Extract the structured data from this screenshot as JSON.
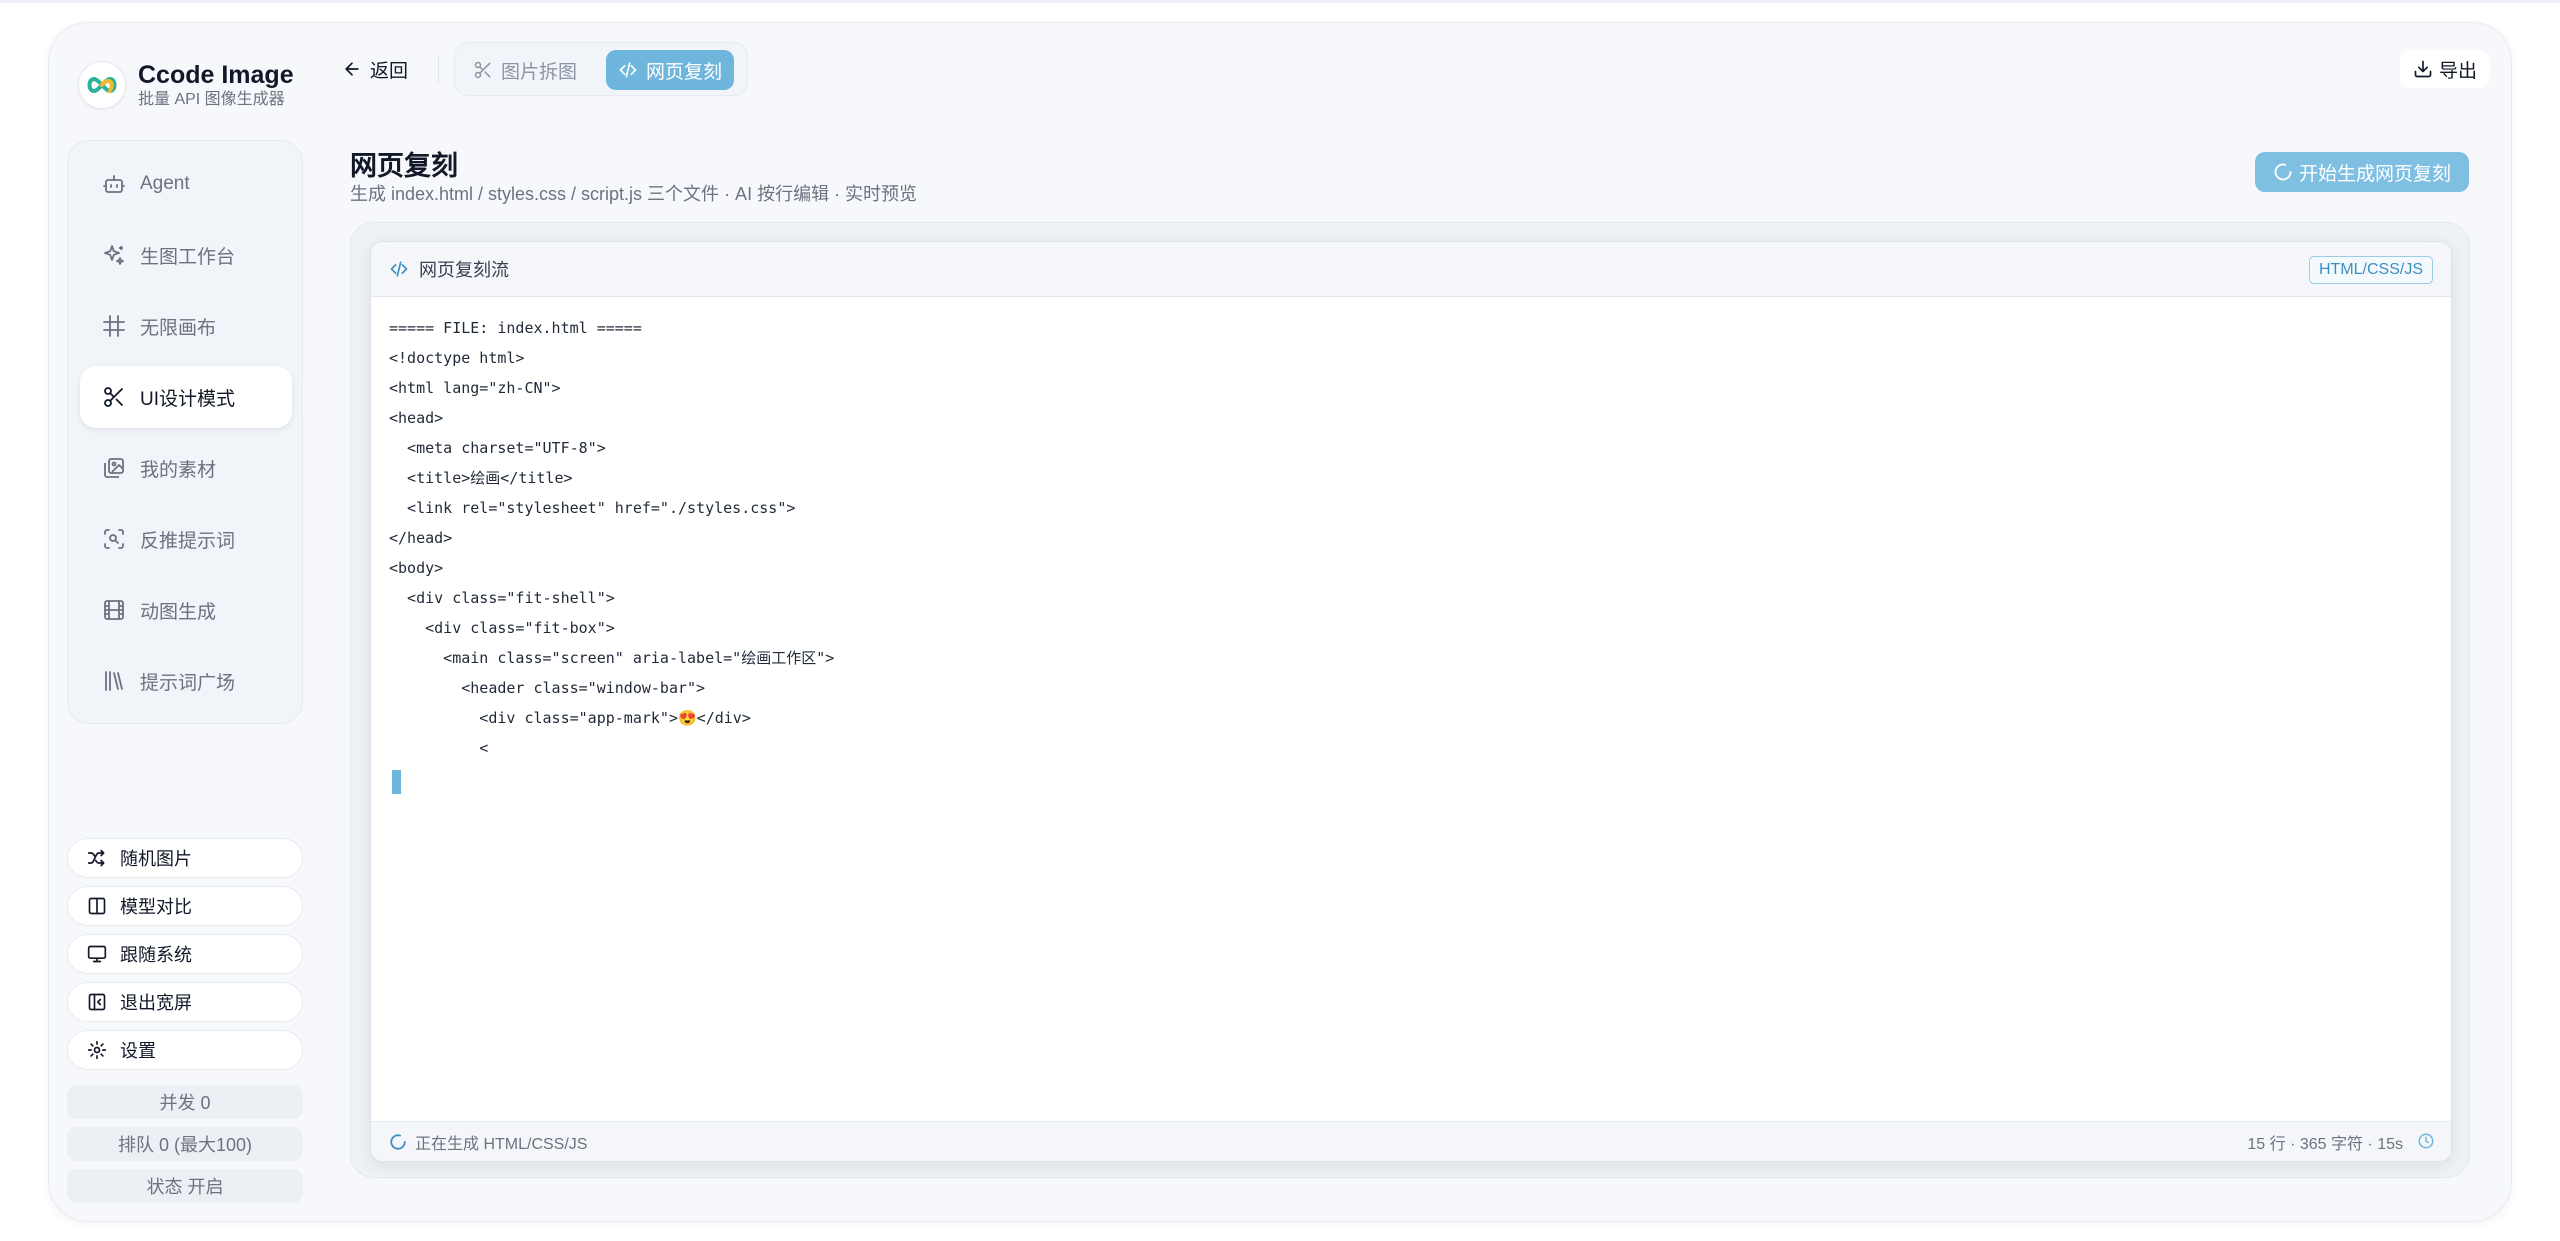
{
  "brand": {
    "title": "Ccode Image",
    "subtitle": "批量 API 图像生成器"
  },
  "nav": [
    {
      "label": "Agent",
      "icon": "robot-icon"
    },
    {
      "label": "生图工作台",
      "icon": "sparkles-icon"
    },
    {
      "label": "无限画布",
      "icon": "hash-grid-icon"
    },
    {
      "label": "UI设计模式",
      "icon": "scissors-icon",
      "active": true
    },
    {
      "label": "我的素材",
      "icon": "image-stack-icon"
    },
    {
      "label": "反推提示词",
      "icon": "scan-search-icon"
    },
    {
      "label": "动图生成",
      "icon": "film-icon"
    },
    {
      "label": "提示词广场",
      "icon": "library-icon"
    }
  ],
  "utilities": [
    {
      "label": "随机图片",
      "icon": "shuffle-icon"
    },
    {
      "label": "模型对比",
      "icon": "columns-icon"
    },
    {
      "label": "跟随系统",
      "icon": "monitor-icon"
    },
    {
      "label": "退出宽屏",
      "icon": "panel-collapse-icon"
    },
    {
      "label": "设置",
      "icon": "gear-icon"
    }
  ],
  "status": {
    "concurrency": "并发 0",
    "queue": "排队 0 (最大100)",
    "state": "状态 开启"
  },
  "topbar": {
    "back_label": "返回",
    "tabs": [
      {
        "label": "图片拆图",
        "icon": "scissors-icon"
      },
      {
        "label": "网页复刻",
        "icon": "code-icon",
        "active": true
      }
    ],
    "export_label": "导出"
  },
  "page": {
    "title": "网页复刻",
    "subtitle": "生成 index.html / styles.css / script.js 三个文件 · AI 按行编辑 · 实时预览",
    "start_button": "开始生成网页复刻"
  },
  "editor": {
    "title": "网页复刻流",
    "badge": "HTML/CSS/JS",
    "lines": [
      "===== FILE: index.html =====",
      "<!doctype html>",
      "<html lang=\"zh-CN\">",
      "<head>",
      "  <meta charset=\"UTF-8\">",
      "  <title>绘画</title>",
      "  <link rel=\"stylesheet\" href=\"./styles.css\">",
      "</head>",
      "<body>",
      "  <div class=\"fit-shell\">",
      "    <div class=\"fit-box\">",
      "      <main class=\"screen\" aria-label=\"绘画工作区\">",
      "        <header class=\"window-bar\">",
      "          <div class=\"app-mark\">😍</div>",
      "          <"
    ],
    "footer_status": "正在生成 HTML/CSS/JS",
    "footer_meta": "15 行 · 365 字符 · 15s"
  },
  "colors": {
    "accent": "#6fb6dc",
    "accent_light": "#7fbfe2",
    "frame_bg": "#f6f8fb"
  }
}
